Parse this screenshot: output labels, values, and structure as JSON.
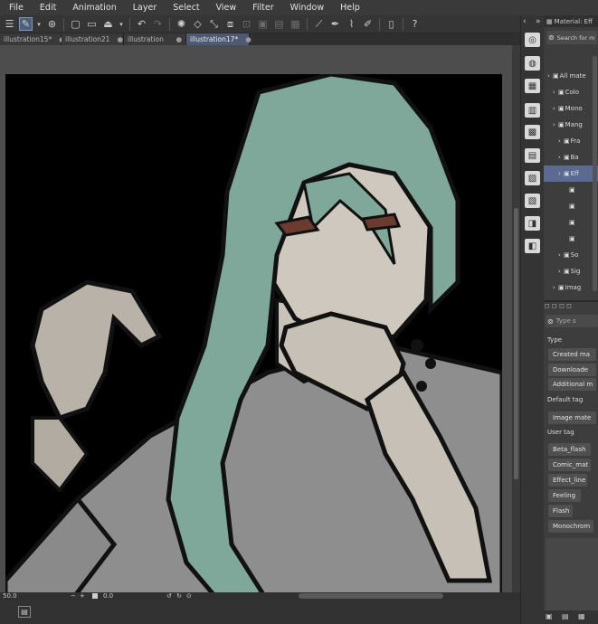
{
  "menu": [
    "File",
    "Edit",
    "Animation",
    "Layer",
    "Select",
    "View",
    "Filter",
    "Window",
    "Help"
  ],
  "toolbar_icons": [
    "menu-icon",
    "pen-tool-icon",
    "chevron-down-icon",
    "canvas-icon",
    "new-file-icon",
    "open-folder-icon",
    "save-icon",
    "save-dropdown-icon",
    "undo-icon",
    "redo-icon",
    "loading-icon",
    "transform-icon",
    "deselect-icon",
    "invert-selection-icon",
    "crop-icon",
    "fill-icon",
    "brush-size-icon",
    "ruler-icon",
    "pen-icon",
    "eraser-icon",
    "tablet-icon",
    "help-icon"
  ],
  "tabs": [
    {
      "label": "illustration15*",
      "modified": "●"
    },
    {
      "label": "illustration21",
      "modified": "●"
    },
    {
      "label": "illustration",
      "modified": "●"
    },
    {
      "label": "illustration17*",
      "modified": "●"
    }
  ],
  "status": {
    "zoom": "50.0",
    "angle": "0.0"
  },
  "panel": {
    "title": "Material: Eff",
    "search_placeholder": "Search for m",
    "tree": [
      {
        "label": "All mate",
        "indent": 0,
        "icon": "folder-icon"
      },
      {
        "label": "Colo",
        "indent": 1,
        "icon": "color-icon"
      },
      {
        "label": "Mono",
        "indent": 1,
        "icon": "mono-icon"
      },
      {
        "label": "Mang",
        "indent": 1,
        "icon": "manga-icon"
      },
      {
        "label": "Fra",
        "indent": 2,
        "icon": "frame-icon"
      },
      {
        "label": "Ba",
        "indent": 2,
        "icon": "balloon-icon"
      },
      {
        "label": "Eff",
        "indent": 2,
        "icon": "effect-icon",
        "selected": true
      },
      {
        "label": "",
        "indent": 3,
        "icon": "burst-icon"
      },
      {
        "label": "",
        "indent": 3,
        "icon": "burst-icon"
      },
      {
        "label": "",
        "indent": 3,
        "icon": "burst-icon"
      },
      {
        "label": "",
        "indent": 3,
        "icon": "burst-icon"
      },
      {
        "label": "So",
        "indent": 2,
        "icon": "sound-icon"
      },
      {
        "label": "Sig",
        "indent": 2,
        "icon": "sign-icon"
      },
      {
        "label": "Imag",
        "indent": 1,
        "icon": "image-icon"
      }
    ],
    "tag_search_placeholder": "Type s",
    "type_heading": "Type",
    "type_buttons": [
      "Created ma",
      "Downloade",
      "Additional m"
    ],
    "default_tag_heading": "Default tag",
    "default_tag_buttons": [
      "Image mate"
    ],
    "user_tag_heading": "User tag",
    "user_tag_buttons": [
      "Beta_flash",
      "Comic_mat",
      "Effect_line",
      "Feeling",
      "Flash",
      "Monochrom"
    ]
  }
}
